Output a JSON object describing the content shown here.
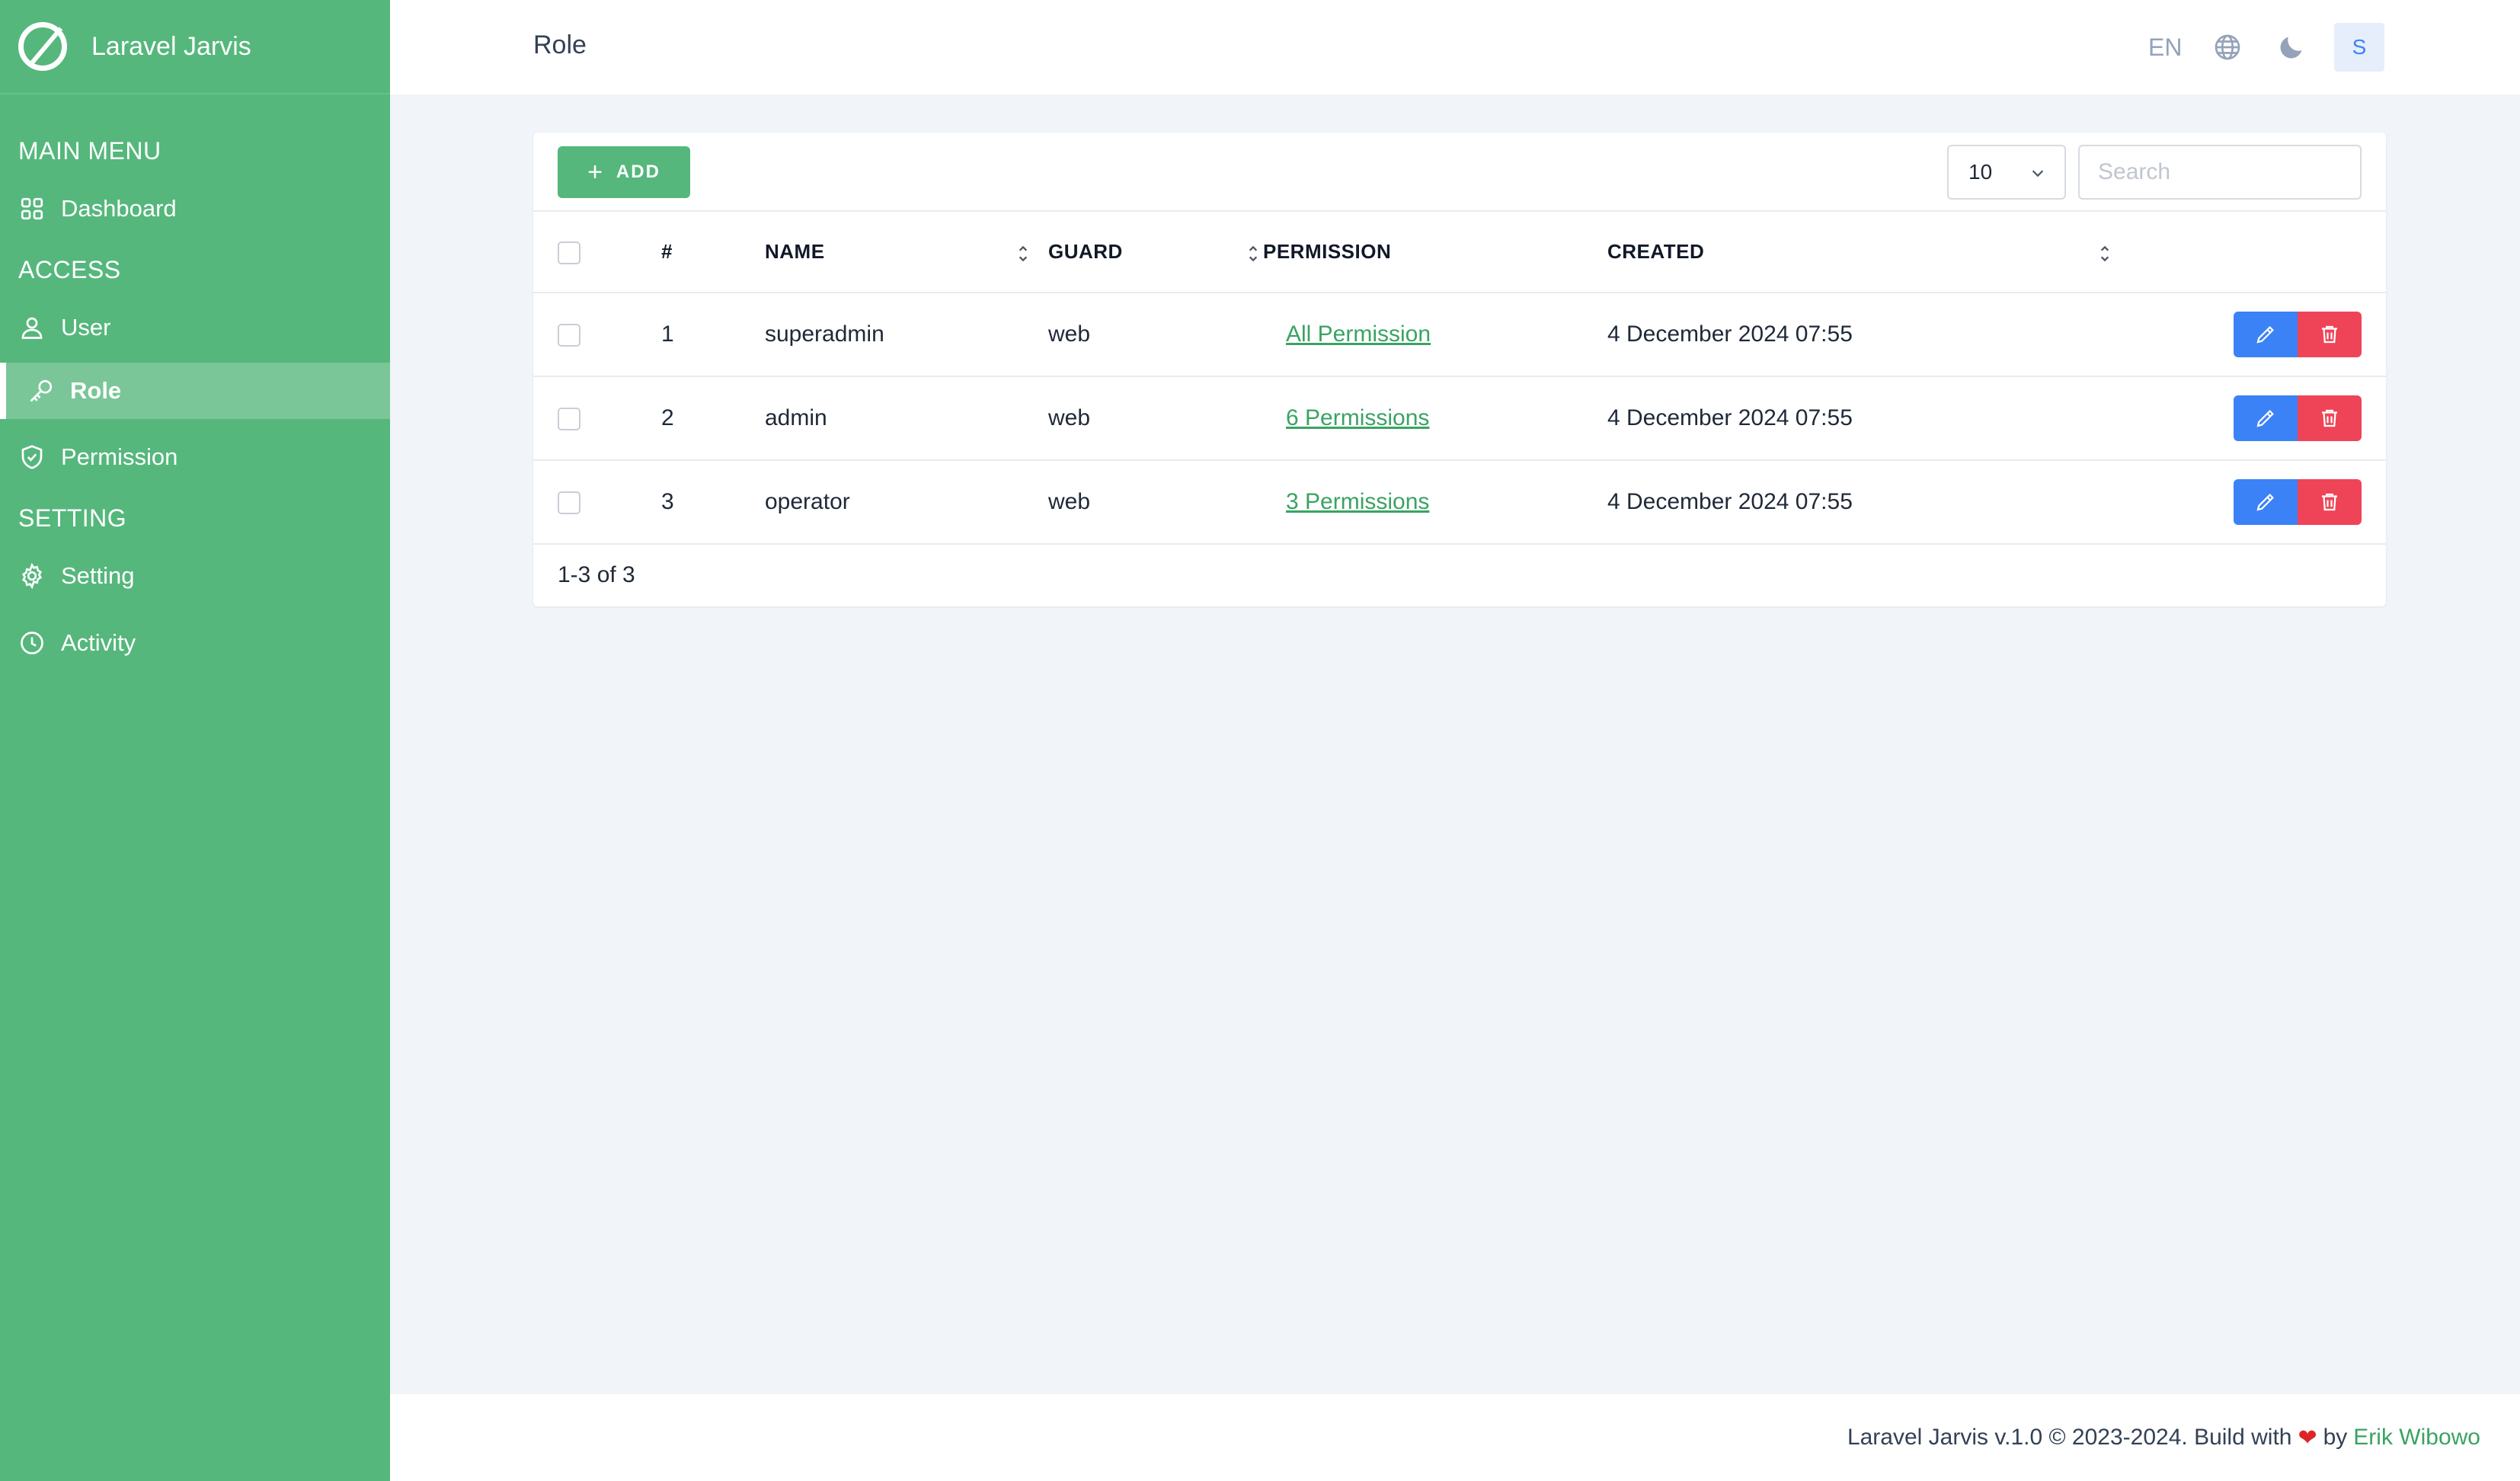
{
  "app": {
    "name": "Laravel Jarvis"
  },
  "sidebar": {
    "sections": [
      {
        "title": "MAIN MENU",
        "items": [
          {
            "label": "Dashboard",
            "icon": "grid-icon"
          }
        ]
      },
      {
        "title": "ACCESS",
        "items": [
          {
            "label": "User",
            "icon": "user-icon"
          },
          {
            "label": "Role",
            "icon": "key-icon",
            "active": true
          },
          {
            "label": "Permission",
            "icon": "shield-check-icon"
          }
        ]
      },
      {
        "title": "SETTING",
        "items": [
          {
            "label": "Setting",
            "icon": "gear-icon"
          },
          {
            "label": "Activity",
            "icon": "clock-icon"
          }
        ]
      }
    ]
  },
  "header": {
    "title": "Role",
    "language": "EN",
    "avatar_initial": "S"
  },
  "toolbar": {
    "add_label": "ADD",
    "per_page": "10",
    "search_placeholder": "Search"
  },
  "table": {
    "columns": {
      "index": "#",
      "name": "NAME",
      "guard": "GUARD",
      "permission": "PERMISSION",
      "created": "CREATED"
    },
    "rows": [
      {
        "index": "1",
        "name": "superadmin",
        "guard": "web",
        "permission": "All Permission",
        "created": "4 December 2024 07:55"
      },
      {
        "index": "2",
        "name": "admin",
        "guard": "web",
        "permission": "6 Permissions",
        "created": "4 December 2024 07:55"
      },
      {
        "index": "3",
        "name": "operator",
        "guard": "web",
        "permission": "3 Permissions",
        "created": "4 December 2024 07:55"
      }
    ],
    "summary": "1-3 of 3"
  },
  "footer": {
    "text": "Laravel Jarvis v.1.0 © 2023-2024. Build with",
    "heart": "❤",
    "by": "by",
    "author": "Erik Wibowo"
  },
  "colors": {
    "brand": "#55b77c",
    "edit": "#3b82f6",
    "delete": "#ef4458",
    "link": "#3aa363"
  }
}
